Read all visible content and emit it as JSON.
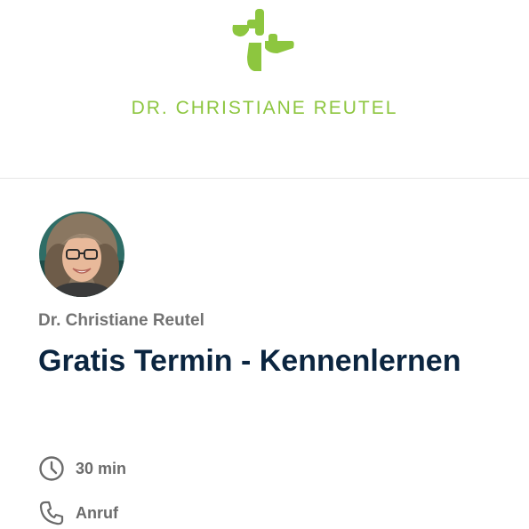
{
  "header": {
    "logo_icon": "reutel-logo-mark",
    "brand_text": "DR. CHRISTIANE REUTEL",
    "brand_color": "#8dc63f"
  },
  "event": {
    "avatar_icon": "organizer-portrait",
    "organizer_name": "Dr. Christiane Reutel",
    "title": "Gratis Termin - Kennenlernen",
    "title_color": "#0b2540",
    "details": [
      {
        "icon": "clock-icon",
        "label": "30 min"
      },
      {
        "icon": "phone-icon",
        "label": "Anruf"
      }
    ]
  }
}
